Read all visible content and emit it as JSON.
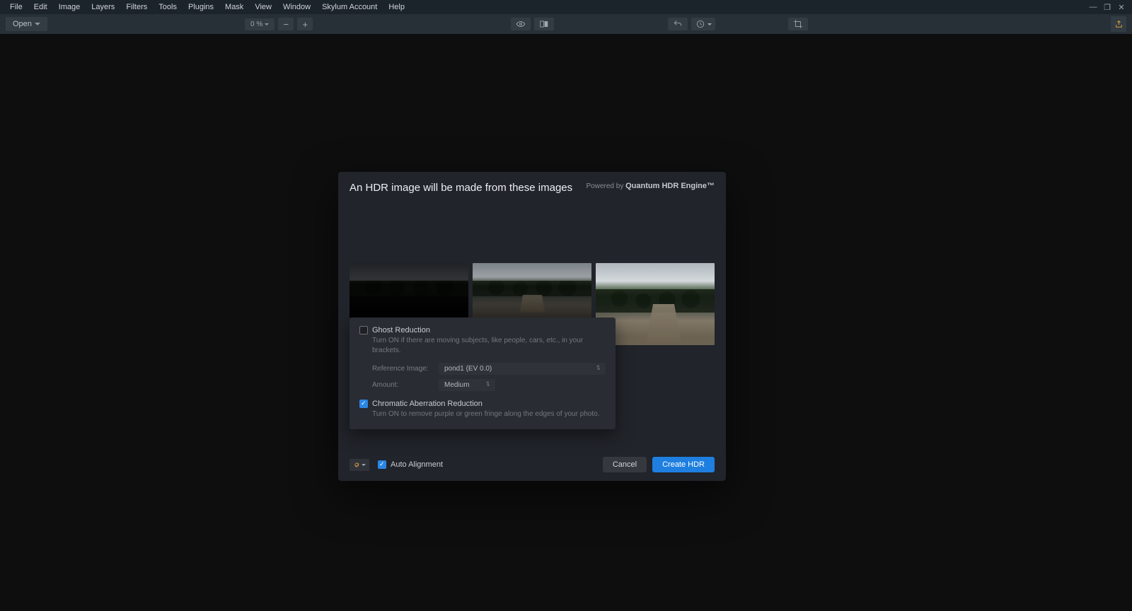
{
  "menu": [
    "File",
    "Edit",
    "Image",
    "Layers",
    "Filters",
    "Tools",
    "Plugins",
    "Mask",
    "View",
    "Window",
    "Skylum Account",
    "Help"
  ],
  "toolbar": {
    "open_label": "Open",
    "zoom_label": "0 %"
  },
  "dialog": {
    "title": "An HDR image will be made from these images",
    "powered_prefix": "Powered by ",
    "powered_brand": "Quantum HDR Engine™",
    "ghost": {
      "label": "Ghost Reduction",
      "desc": "Turn ON if there are moving subjects, like people, cars, etc., in your brackets.",
      "checked": false,
      "reference_label": "Reference Image:",
      "reference_value": "pond1 (EV 0.0)",
      "amount_label": "Amount:",
      "amount_value": "Medium"
    },
    "chroma": {
      "label": "Chromatic Aberration Reduction",
      "desc": "Turn ON to remove purple or green fringe along the edges of your photo.",
      "checked": true
    },
    "auto_alignment": {
      "label": "Auto Alignment",
      "checked": true
    },
    "cancel": "Cancel",
    "create": "Create HDR"
  }
}
